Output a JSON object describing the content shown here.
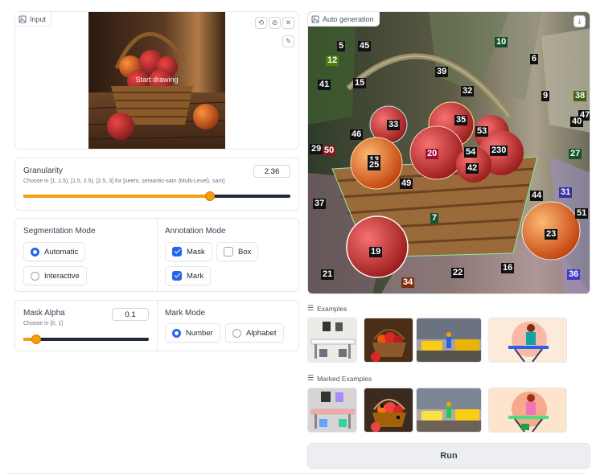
{
  "input_panel": {
    "tag": "Input",
    "canvas_hint": "Start drawing",
    "buttons": {
      "undo": "⟲",
      "clear": "⊘",
      "close": "✕",
      "brush": "✎"
    }
  },
  "output_panel": {
    "tag": "Auto generation",
    "download": "⤓",
    "marks": [
      {
        "n": "5",
        "c": "#111"
      },
      {
        "n": "45",
        "c": "#111"
      },
      {
        "n": "10",
        "c": "#134e2a"
      },
      {
        "n": "12",
        "c": "#4d7c0f"
      },
      {
        "n": "6",
        "c": "#111"
      },
      {
        "n": "39",
        "c": "#111"
      },
      {
        "n": "41",
        "c": "#111"
      },
      {
        "n": "15",
        "c": "#111"
      },
      {
        "n": "32",
        "c": "#111"
      },
      {
        "n": "9",
        "c": "#111"
      },
      {
        "n": "38",
        "c": "#3f6212"
      },
      {
        "n": "47",
        "c": "#111"
      },
      {
        "n": "40",
        "c": "#111"
      },
      {
        "n": "33",
        "c": "#111"
      },
      {
        "n": "35",
        "c": "#111"
      },
      {
        "n": "46",
        "c": "#111"
      },
      {
        "n": "53",
        "c": "#111"
      },
      {
        "n": "29",
        "c": "#111"
      },
      {
        "n": "50",
        "c": "#7f1d1d"
      },
      {
        "n": "20",
        "c": "#9f1239"
      },
      {
        "n": "54",
        "c": "#111"
      },
      {
        "n": "230",
        "c": "#111"
      },
      {
        "n": "27",
        "c": "#14532d"
      },
      {
        "n": "13",
        "c": "#111"
      },
      {
        "n": "25",
        "c": "#111"
      },
      {
        "n": "42",
        "c": "#111"
      },
      {
        "n": "49",
        "c": "#111"
      },
      {
        "n": "31",
        "c": "#3730a3"
      },
      {
        "n": "37",
        "c": "#111"
      },
      {
        "n": "44",
        "c": "#111"
      },
      {
        "n": "51",
        "c": "#111"
      },
      {
        "n": "7",
        "c": "#14532d"
      },
      {
        "n": "23",
        "c": "#111"
      },
      {
        "n": "19",
        "c": "#111"
      },
      {
        "n": "16",
        "c": "#111"
      },
      {
        "n": "21",
        "c": "#111"
      },
      {
        "n": "34",
        "c": "#7c2d12"
      },
      {
        "n": "22",
        "c": "#111"
      },
      {
        "n": "36",
        "c": "#4338ca"
      }
    ]
  },
  "granularity": {
    "label": "Granularity",
    "value": "2.36",
    "hint": "Choose in [1, 1.5), [1.5, 2.5), [2.5, 3] for [seem, semantic-sam (Multi-Level), sam]",
    "fraction": 0.7
  },
  "segmentation_mode": {
    "label": "Segmentation Mode",
    "options": [
      "Automatic",
      "Interactive"
    ],
    "selected": "Automatic"
  },
  "annotation_mode": {
    "label": "Annotation Mode",
    "options": [
      {
        "label": "Mask",
        "checked": true
      },
      {
        "label": "Box",
        "checked": false
      },
      {
        "label": "Mark",
        "checked": true
      }
    ]
  },
  "mask_alpha": {
    "label": "Mask Alpha",
    "value": "0.1",
    "hint": "Choose in [0, 1]",
    "fraction": 0.1
  },
  "mark_mode": {
    "label": "Mark Mode",
    "options": [
      "Number",
      "Alphabet"
    ],
    "selected": "Number"
  },
  "examples": {
    "title": "Examples"
  },
  "marked_examples": {
    "title": "Marked Examples"
  },
  "run_button": {
    "label": "Run"
  },
  "colors": {
    "accent": "#f59e0b",
    "primary": "#2563eb"
  }
}
